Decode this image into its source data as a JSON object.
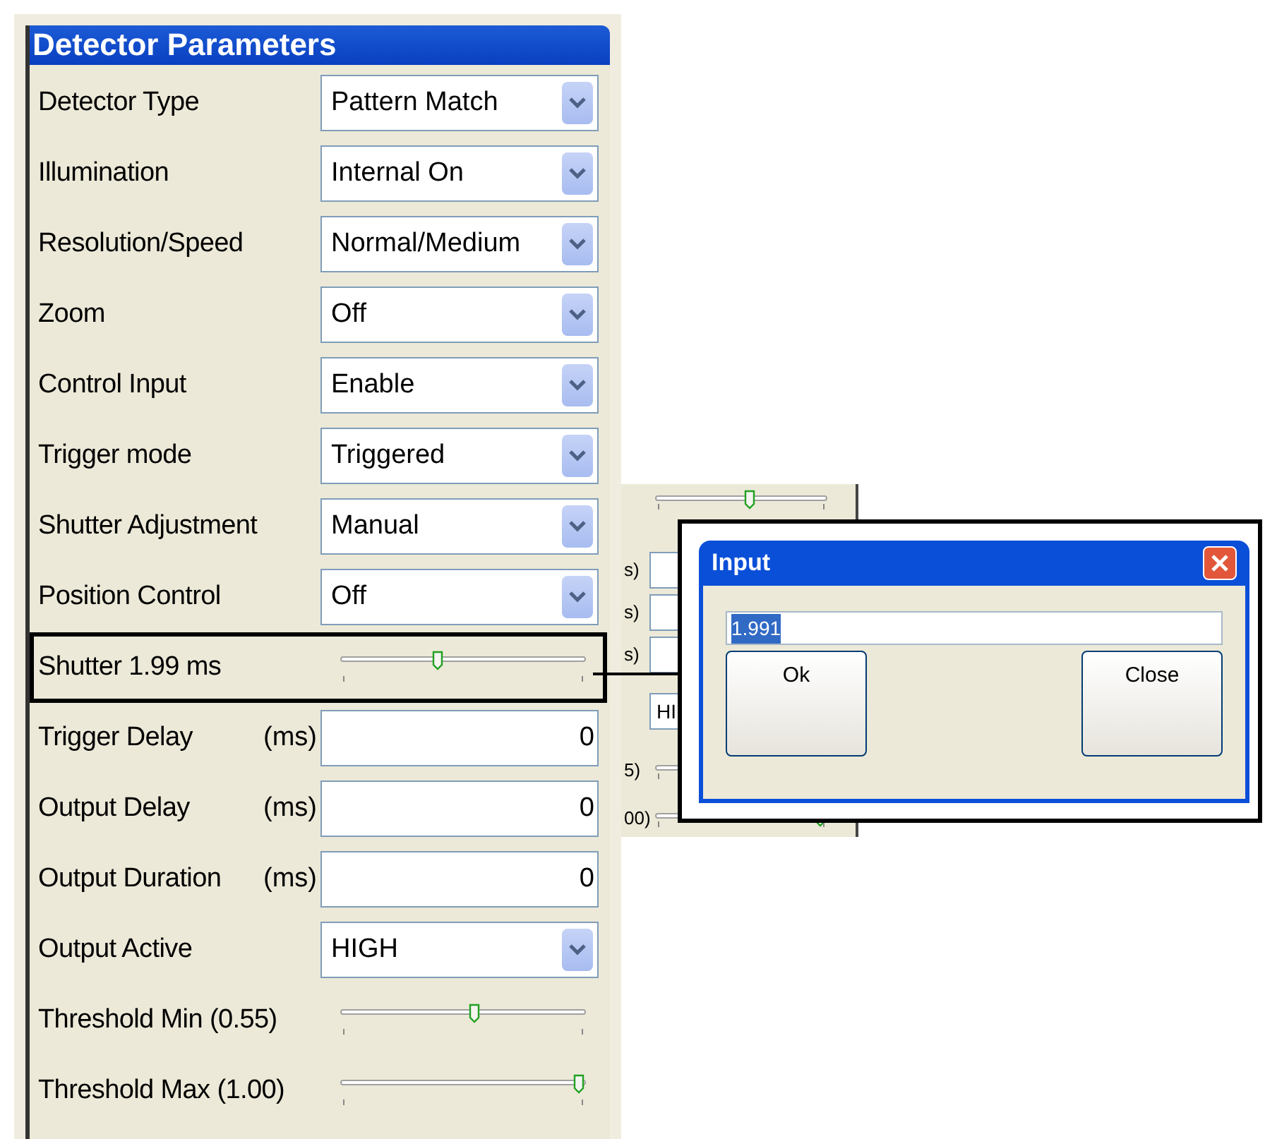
{
  "panel": {
    "title": "Detector Parameters",
    "rows": [
      {
        "kind": "dropdown",
        "label": "Detector Type",
        "value": "Pattern Match",
        "highlighted": false
      },
      {
        "kind": "dropdown",
        "label": "Illumination",
        "value": "Internal On",
        "highlighted": false
      },
      {
        "kind": "dropdown",
        "label": "Resolution/Speed",
        "value": "Normal/Medium",
        "highlighted": false
      },
      {
        "kind": "dropdown",
        "label": "Zoom",
        "value": "Off",
        "highlighted": false
      },
      {
        "kind": "dropdown",
        "label": "Control Input",
        "value": "Enable",
        "highlighted": false
      },
      {
        "kind": "dropdown",
        "label": "Trigger mode",
        "value": "Triggered",
        "highlighted": false
      },
      {
        "kind": "dropdown",
        "label": "Shutter Adjustment",
        "value": "Manual",
        "highlighted": false
      },
      {
        "kind": "dropdown",
        "label": "Position Control",
        "value": "Off",
        "highlighted": false
      },
      {
        "kind": "slider",
        "label": "Shutter 1.99 ms",
        "level": 0.39,
        "highlighted": true
      },
      {
        "kind": "number",
        "label": "Trigger Delay",
        "unit": "(ms)",
        "value": "0",
        "highlighted": false
      },
      {
        "kind": "number",
        "label": "Output Delay",
        "unit": "(ms)",
        "value": "0",
        "highlighted": false
      },
      {
        "kind": "number",
        "label": "Output Duration",
        "unit": "(ms)",
        "value": "0",
        "highlighted": false
      },
      {
        "kind": "dropdown",
        "label": "Output Active",
        "value": "HIGH",
        "highlighted": false
      },
      {
        "kind": "slider",
        "label": "Threshold Min (0.55)",
        "level": 0.55,
        "highlighted": false
      },
      {
        "kind": "slider",
        "label": "Threshold Max (1.00)",
        "level": 1.0,
        "highlighted": false
      }
    ]
  },
  "background_panel": {
    "rows": [
      {
        "kind": "slider",
        "level": 0.55
      },
      {
        "kind": "number",
        "label": "s)"
      },
      {
        "kind": "number",
        "label": "s)"
      },
      {
        "kind": "number",
        "label": "s)"
      },
      {
        "kind": "dropdown",
        "value": "HI"
      },
      {
        "kind": "slider",
        "label": "5)"
      },
      {
        "kind": "slider",
        "label": "00)",
        "level": 1.0
      }
    ]
  },
  "dialog": {
    "title": "Input",
    "value": "1.991",
    "value_selected": true,
    "buttons": [
      "Ok",
      "Close"
    ]
  }
}
